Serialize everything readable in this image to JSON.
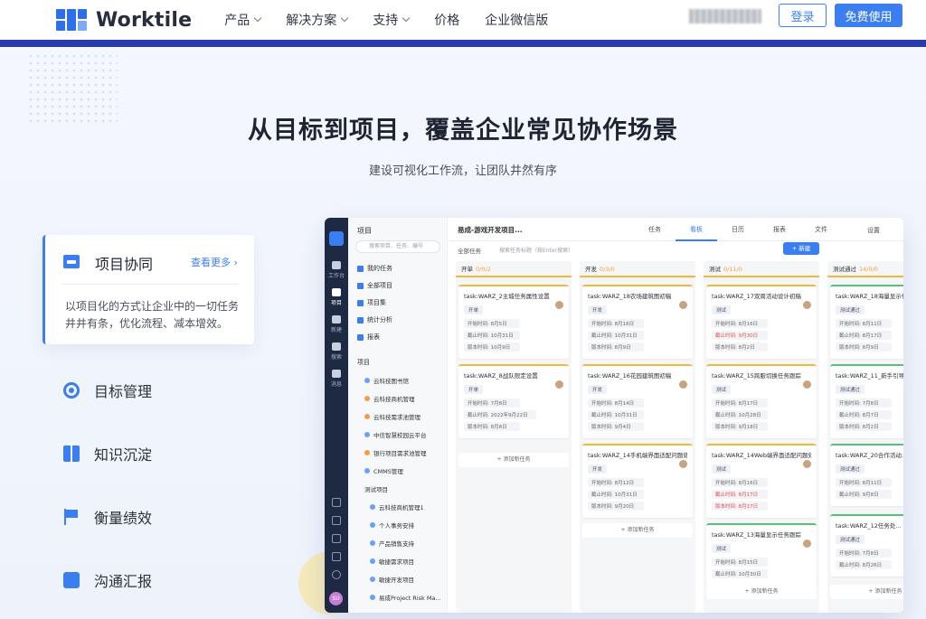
{
  "nav": {
    "brand": "Worktile",
    "menu": [
      {
        "label": "产品",
        "dropdown": true
      },
      {
        "label": "解决方案",
        "dropdown": true
      },
      {
        "label": "支持",
        "dropdown": true
      },
      {
        "label": "价格",
        "dropdown": false
      },
      {
        "label": "企业微信版",
        "dropdown": false
      }
    ],
    "login": "登录",
    "free": "免费使用"
  },
  "hero": {
    "title": "从目标到项目，覆盖企业常见协作场景",
    "subtitle": "建设可视化工作流，让团队井然有序"
  },
  "features": {
    "active": {
      "title": "项目协同",
      "more": "查看更多",
      "desc": "以项目化的方式让企业中的一切任务井井有条，优化流程、减本增效。"
    },
    "items": [
      "目标管理",
      "知识沉淀",
      "衡量绩效",
      "沟通汇报"
    ]
  },
  "app": {
    "rail": [
      {
        "label": "工作台"
      },
      {
        "label": "项目"
      },
      {
        "label": "新建"
      },
      {
        "label": "搜索"
      },
      {
        "label": "消息"
      }
    ],
    "avatar": "SU",
    "sidebar": {
      "title": "项目",
      "search_placeholder": "搜索项目、任务、编号",
      "items": [
        "我的任务",
        "全部项目",
        "项目集",
        "统计分析",
        "报表"
      ],
      "section": "项目",
      "projects": [
        "云科技图书馆",
        "云科技商机管理",
        "云科技需求池管理",
        "中信智慧校园云平台",
        "银行项目需求池管理",
        "CMMS管理"
      ],
      "group": "测试项目",
      "group_projects": [
        "云科技商机管理1",
        "个人事务安排",
        "产品销售支持",
        "敏捷需求项目",
        "敏捷开发项目",
        "易成Project Risk Ma..."
      ]
    },
    "toolbar": {
      "project": "易成-游戏开发项目...",
      "tabs": [
        "任务",
        "看板",
        "日历",
        "报表",
        "文件"
      ],
      "active_tab": "看板",
      "settings": "设置",
      "filter": "全部任务",
      "search_placeholder": "搜索任务标题（按Enter搜索）",
      "new": "+ 新建"
    },
    "columns": [
      {
        "name": "开单",
        "count": "0/0/2",
        "cards": [
          {
            "title": "task:WARZ_2主城任务属性设置",
            "status": "开单",
            "start": "开始时间: 8月5日",
            "end": "截止时间: 10月31日",
            "ver": "版本时间: 10月9日",
            "tag": "图卡"
          },
          {
            "title": "task:WARZ_8战队限定设置",
            "status": "开单",
            "start": "开始时间: 7月8日",
            "end": "截止时间: 2022年9月22日",
            "ver": "版本时间: 8月8日",
            "tag": "图卡"
          }
        ],
        "add": "+ 添加新任务"
      },
      {
        "name": "开发",
        "count": "0/3/0",
        "cards": [
          {
            "title": "task:WARZ_18农场建筑图初稿",
            "status": "开发",
            "start": "开始时间: 8月16日",
            "end": "截止时间: 10月31日",
            "ver": "版本时间: 8月9日",
            "tag": "图卡"
          },
          {
            "title": "task:WARZ_16花园建筑图初稿",
            "status": "开发",
            "start": "开始时间: 8月14日",
            "end": "截止时间: 10月31日",
            "ver": "版本时间: 9月4日",
            "tag": "切图"
          },
          {
            "title": "task:WARZ_14手机端界面适配问题处理",
            "status": "开发",
            "start": "开始时间: 8月12日",
            "end": "截止时间: 10月31日",
            "ver": "版本时间: 9月20日",
            "tag": "QA"
          }
        ],
        "add": "+ 添加新任务"
      },
      {
        "name": "测试",
        "count": "0/11/0",
        "cards": [
          {
            "title": "task:WARZ_17双周活动设计初稿",
            "status": "测试",
            "start": "开始时间: 8月16日",
            "end": "截止时间: 9月30日",
            "ver": "版本时间: 8月2日",
            "tag": "图卡"
          },
          {
            "title": "task:WARZ_15跨服切换任务跟踪",
            "status": "测试",
            "start": "开始时间: 8月17日",
            "end": "截止时间: 10月28日",
            "ver": "版本时间: 9月18日",
            "tag": ""
          },
          {
            "title": "task:WARZ_14Web端界面适配问题处理",
            "status": "测试",
            "start": "开始时间: 8月16日",
            "end": "截止时间: 8月17日",
            "ver": "版本时间: 8月17日",
            "tag": "图卡"
          },
          {
            "title": "task:WARZ_13海量显示任务跟踪",
            "status": "测试",
            "start": "开始时间: 8月15日",
            "end": "截止时间: 10月30日",
            "ver": "",
            "tag": ""
          }
        ],
        "add": "+ 添加新任务"
      },
      {
        "name": "测试通过",
        "count": "14/0/0",
        "cards": [
          {
            "title": "task:WARZ_18海量显示任务...",
            "status": "测试通过",
            "start": "开始时间: 8月11日",
            "end": "截止时间: 8月17日",
            "ver": "版本时间: 8月9日",
            "tag": ""
          },
          {
            "title": "task:WARZ_11_新手引导...",
            "status": "测试通过",
            "start": "开始时间: 7月8日",
            "end": "截止时间: 8月7日",
            "ver": "版本时间: 8月2日",
            "tag": ""
          },
          {
            "title": "task:WARZ_20合作活动...",
            "status": "测试通过",
            "start": "开始时间: 8月11日",
            "end": "截止时间: 9月8日",
            "ver": "",
            "tag": ""
          },
          {
            "title": "task:WARZ_12任务处...",
            "status": "测试通过",
            "start": "开始时间: 7月8日",
            "end": "截止时间: 8月26日",
            "ver": "",
            "tag": ""
          }
        ],
        "add": "+ 添加新任务"
      }
    ]
  },
  "colors": {
    "accent": "#3b7ef0",
    "brand_bar": "#2a3caa",
    "warning": "#f3b73b",
    "success": "#55c27a"
  }
}
